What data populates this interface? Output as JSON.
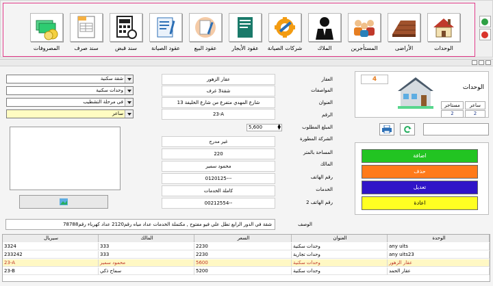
{
  "toolbar": {
    "items": [
      {
        "label": "الوحدات",
        "icon": "house-icon"
      },
      {
        "label": "الأراضى",
        "icon": "land-icon"
      },
      {
        "label": "المستأجرين",
        "icon": "tenants-icon"
      },
      {
        "label": "الملاك",
        "icon": "owner-icon"
      },
      {
        "label": "شركات الصيانة",
        "icon": "maintenance-gear-icon"
      },
      {
        "label": "عقود الأيجار",
        "icon": "rent-contract-icon"
      },
      {
        "label": "عقود البيع",
        "icon": "sale-contract-icon"
      },
      {
        "label": "عقود الصيانة",
        "icon": "maintenance-contract-icon"
      },
      {
        "label": "سند قبض",
        "icon": "receipt-calculator-icon"
      },
      {
        "label": "سند صرف",
        "icon": "invoice-icon"
      },
      {
        "label": "المصروفات",
        "icon": "money-coins-icon"
      }
    ],
    "ok_color": "#2ea043",
    "close_color": "#d9342b"
  },
  "combos": [
    "شقة سكنية",
    "وحدات سكنية",
    "فى مرحلة التشطيب",
    "ساعر"
  ],
  "fields": {
    "property": "عقار الزهور",
    "specs": "شقة3 غرف",
    "address": "شارع المهدي  متفرع من شارع الخليفة 13",
    "number": "23-A",
    "price": "5,600",
    "company": "غير مدرج",
    "area": "220",
    "owner": "محمود سمير",
    "phone": "0120125---",
    "services": "كاملة الخدمات",
    "phone2": "00212554--"
  },
  "labels": {
    "property": "العقار",
    "specs": "المواصفات",
    "address": "العنوان",
    "number": "الرقم",
    "price": "المبلغ المطلوب",
    "company": "الشركة المطورة",
    "area": "المساحة بالمتر",
    "owner": "المالك",
    "phone": "رقم الهاتف",
    "services": "الخدمات",
    "phone2": "رقم الهاتف 2",
    "description": "الوصف"
  },
  "description": "شقة في الدور الرابع تطل  علي فيو مفتوح  , مكتملة الخدمات عداد مياه رقم2120  عداد كهرباء رقم78788",
  "unit_card": {
    "count": "4",
    "title": "الوحدات",
    "chip1_label": "ساعر",
    "chip1_value": "2",
    "chip2_label": "مستاجر",
    "chip2_value": "2"
  },
  "actions": {
    "add": "اضافة",
    "delete": "حذف",
    "edit": "تعديل",
    "reset": "اعادة",
    "colors": {
      "add": "#22c422",
      "delete": "#ff7a1a",
      "edit": "#3014c8",
      "reset": "#ffff22"
    }
  },
  "table": {
    "headers": [
      "الوحدة",
      "العنوان",
      "السعر",
      "المالك",
      "سيريال"
    ],
    "rows": [
      [
        "any uits",
        "وحدات سكنية",
        "2230",
        "333",
        "3324"
      ],
      [
        "any uits23",
        "وحدات تجارية",
        "2230",
        "333",
        "233242"
      ],
      [
        "عقار الزهور",
        "وحدات سكنية",
        "5600",
        "محمود سمير",
        "23-A"
      ],
      [
        "عقار الحمد",
        "وحدات سكنية",
        "5200",
        "سماح ذكي",
        "23-B"
      ]
    ],
    "selected_row": 2,
    "selected_text_color": "#c0392b",
    "selected_bg": "#fff8c4"
  }
}
